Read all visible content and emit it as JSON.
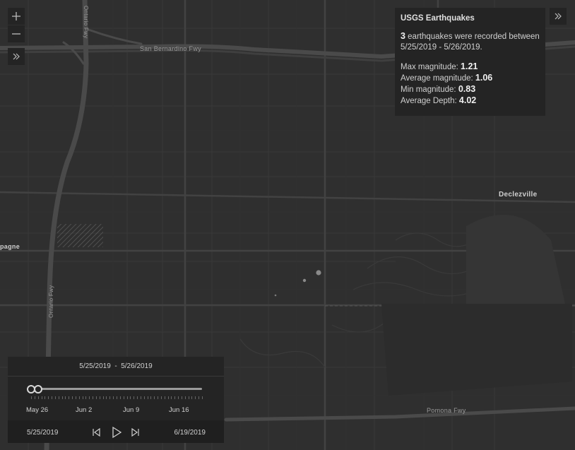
{
  "map": {
    "labels": {
      "san_bernardino_fwy": "San Bernardino Fwy",
      "ontario_fwy_top": "Ontario Fwy",
      "ontario_fwy_bottom": "Ontario Fwy",
      "declezville": "Declezville",
      "pomona_fwy": "Pomona Fwy",
      "mirage": "pagne"
    },
    "colors": {
      "background": "#2f2f2f",
      "road": "#3c3c3c",
      "freeway": "#444444",
      "point": "#8a8a8a"
    }
  },
  "controls": {
    "zoom_in_icon": "plus-icon",
    "zoom_out_icon": "minus-icon",
    "expand_icon": "double-chevron-right-icon"
  },
  "info_panel": {
    "title": "USGS Earthquakes",
    "count": "3",
    "count_text": " earthquakes were recorded between 5/25/2019 - 5/26/2019.",
    "max_label": "Max magnitude: ",
    "max_value": "1.21",
    "avg_label": "Average magnitude: ",
    "avg_value": "1.06",
    "min_label": "Min magnitude: ",
    "min_value": "0.83",
    "depth_label": "Average Depth: ",
    "depth_value": "4.02"
  },
  "time_slider": {
    "current_range": "5/25/2019  -  5/26/2019",
    "tick_labels": [
      "May 26",
      "Jun 2",
      "Jun 9",
      "Jun 16"
    ],
    "start_date": "5/25/2019",
    "end_date": "6/19/2019",
    "selection_start_fraction": 0.0,
    "selection_end_fraction": 0.04
  }
}
